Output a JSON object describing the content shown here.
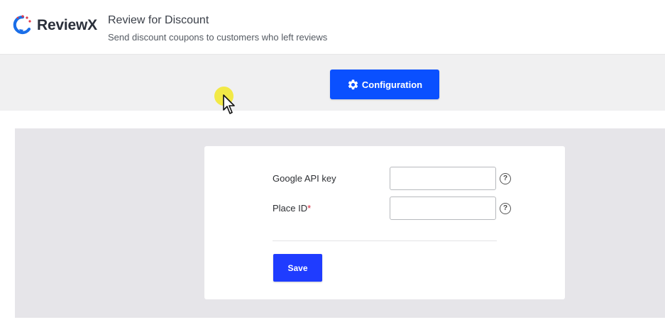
{
  "brand": {
    "name": "ReviewX",
    "logo_icon": "reviewx-logo-icon",
    "primary_color": "#0a50ff"
  },
  "header": {
    "title": "Review for Discount",
    "subtitle": "Send discount coupons to customers who left reviews"
  },
  "toolbar": {
    "configuration_label": "Configuration",
    "configuration_icon": "gear-icon"
  },
  "form": {
    "fields": [
      {
        "label": "Google API key",
        "required": false,
        "value": "",
        "help_icon": "question-mark-icon"
      },
      {
        "label": "Place ID",
        "required": true,
        "required_mark": "*",
        "value": "",
        "help_icon": "question-mark-icon"
      }
    ],
    "help_glyph": "?",
    "save_label": "Save",
    "save_color": "#1f3cff",
    "required_color": "#d6243a"
  },
  "cursor": {
    "icon": "mouse-pointer-icon",
    "highlight_color": "#f2e828"
  }
}
